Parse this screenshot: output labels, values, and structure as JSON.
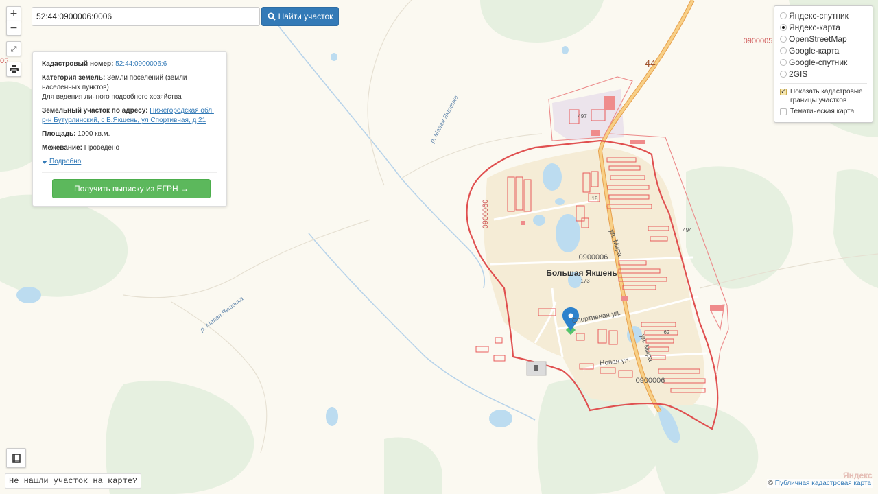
{
  "search": {
    "value": "52:44:0900006:0006",
    "button_label": "Найти участок"
  },
  "zoom": {
    "in_label": "+",
    "out_label": "−"
  },
  "info": {
    "cadastral_label": "Кадастровый номер:",
    "cadastral_value": "52:44:0900006:6",
    "category_label": "Категория земель:",
    "category_value": "Земли поселений (земли населенных пунктов)",
    "use_value": "Для ведения личного подсобного хозяйства",
    "address_label": "Земельный участок по адресу:",
    "address_value": "Нижегородская обл, р-н Бутурлинский, с Б.Якшень, ул Спортивная, д 21",
    "area_label": "Площадь:",
    "area_value": "1000 кв.м.",
    "survey_label": "Межевание:",
    "survey_value": "Проведено",
    "details_label": "Подробно",
    "egrn_button": "Получить выписку из ЕГРН →"
  },
  "layers": {
    "base_options": [
      {
        "label": "Яндекс-спутник",
        "selected": false
      },
      {
        "label": "Яндекс-карта",
        "selected": true
      },
      {
        "label": "OpenStreetMap",
        "selected": false
      },
      {
        "label": "Google-карта",
        "selected": false
      },
      {
        "label": "Google-спутник",
        "selected": false
      },
      {
        "label": "2GIS",
        "selected": false
      }
    ],
    "show_borders_label": "Показать кадастровые границы участков",
    "show_borders_checked": true,
    "thematic_label": "Тематическая карта",
    "thematic_checked": false
  },
  "map_labels": {
    "village": "Большая Якшень",
    "street_sport": "Спортивная ул.",
    "street_mira": "ул. Мира",
    "street_mira2": "ул. Мира",
    "street_new": "Новая ул.",
    "river1": "р. Малая Якшенка",
    "river2": "р. Малая Якшенка",
    "road_number": "44",
    "quarter_main": "0900006",
    "quarter_bottom": "0900006",
    "quarter_west": "0900060",
    "quarter_ne": "0900005",
    "edge_left": "05",
    "plot_497": "497",
    "plot_494": "494",
    "plot_18": "18",
    "plot_173": "173",
    "plot_62": "62"
  },
  "bottom": {
    "not_found": "Не нашли участок на карте?",
    "attribution_prefix": "© ",
    "attribution_link": "Публичная кадастровая карта",
    "yandex": "Яндекс"
  },
  "colors": {
    "map_bg": "#fbf9f1",
    "forest": "#e6f0e0",
    "settlement": "#f5ecd6",
    "water": "#bcdcf0",
    "cadastral_border": "#e05050",
    "road": "#f4bf6a",
    "accent_blue": "#337ab7",
    "accent_green": "#5cb85c"
  }
}
